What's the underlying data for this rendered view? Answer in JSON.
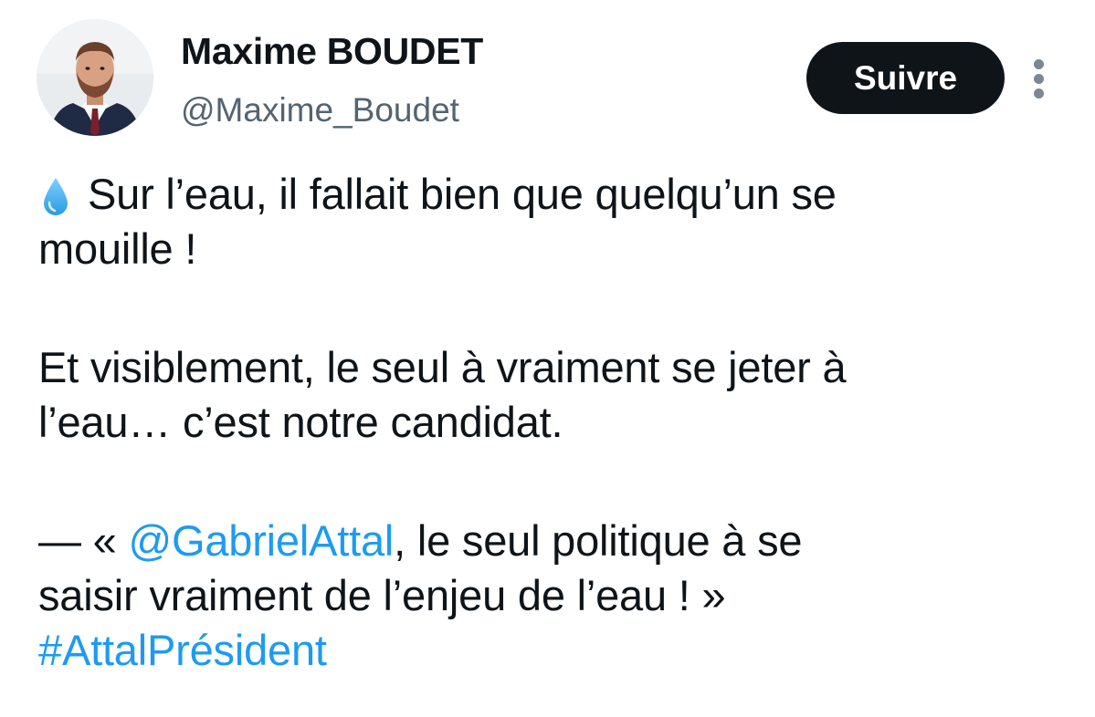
{
  "author": {
    "display_name": "Maxime BOUDET",
    "handle": "@Maxime_Boudet"
  },
  "actions": {
    "follow_label": "Suivre",
    "more_icon": "more-vertical-icon"
  },
  "tweet": {
    "line1_after_icon": "Sur l’eau, il fallait bien que quelqu’un se",
    "line2": "mouille !",
    "line3": "Et visiblement, le seul à vraiment se jeter à",
    "line4": "l’eau… c’est notre candidat.",
    "line5_prefix": "— « ",
    "line5_mention": "@GabrielAttal",
    "line5_suffix": ", le seul politique à se",
    "line6": "saisir vraiment de l’enjeu de l’eau ! »",
    "hashtag": "#AttalPrésident",
    "leading_icon": "water-drop-icon"
  },
  "colors": {
    "link": "#1d9bf0",
    "text": "#0f1419",
    "secondary": "#536471",
    "button_bg": "#0f1419",
    "button_text": "#ffffff"
  }
}
